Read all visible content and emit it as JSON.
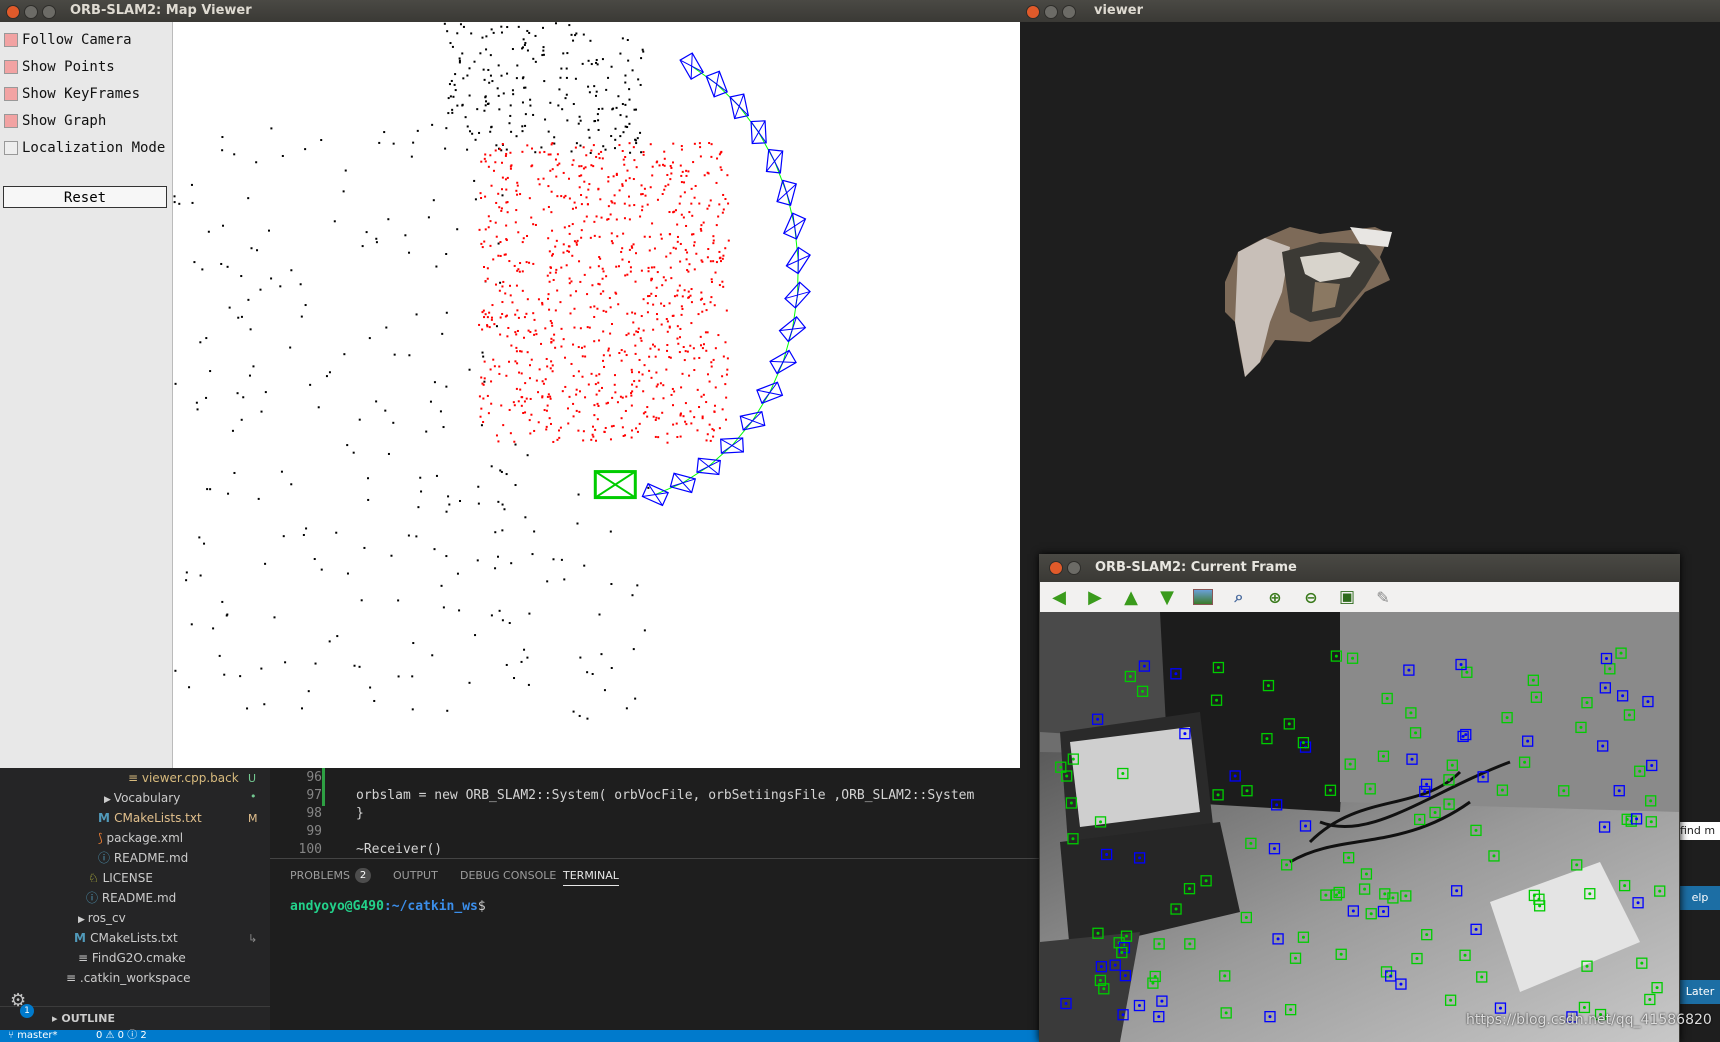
{
  "map_viewer": {
    "title": "ORB-SLAM2: Map Viewer",
    "options": [
      {
        "label": "Follow Camera",
        "checked": true
      },
      {
        "label": "Show Points",
        "checked": true
      },
      {
        "label": "Show KeyFrames",
        "checked": true
      },
      {
        "label": "Show Graph",
        "checked": true
      },
      {
        "label": "Localization Mode",
        "checked": false
      }
    ],
    "reset_label": "Reset"
  },
  "viewer": {
    "title": "viewer"
  },
  "current_frame": {
    "title": "ORB-SLAM2: Current Frame",
    "tools": [
      "arrow-left-icon",
      "arrow-right-icon",
      "arrow-up-icon",
      "arrow-down-icon",
      "image-icon",
      "zoom-fit-icon",
      "zoom-in-icon",
      "zoom-out-icon",
      "save-icon",
      "brush-icon"
    ]
  },
  "explorer": {
    "items": [
      {
        "label": "viewer.cpp.back",
        "badge": "U"
      },
      {
        "label": "Vocabulary",
        "badge": "•"
      },
      {
        "label": "CMakeLists.txt",
        "badge": "M"
      },
      {
        "label": "package.xml",
        "badge": ""
      },
      {
        "label": "README.md",
        "badge": ""
      },
      {
        "label": "LICENSE",
        "badge": ""
      },
      {
        "label": "README.md",
        "badge": ""
      },
      {
        "label": "ros_cv",
        "badge": ""
      },
      {
        "label": "CMakeLists.txt",
        "badge": ""
      },
      {
        "label": "FindG2O.cmake",
        "badge": ""
      },
      {
        "label": ".catkin_workspace",
        "badge": ""
      }
    ],
    "outline_label": "OUTLINE"
  },
  "code": {
    "lines": [
      {
        "n": "96",
        "text": ""
      },
      {
        "n": "97",
        "text": "  orbslam = new ORB_SLAM2::System( orbVocFile, orbSetiingsFile ,ORB_SLAM2::System"
      },
      {
        "n": "98",
        "text": "}"
      },
      {
        "n": "99",
        "text": ""
      },
      {
        "n": "100",
        "text": "~Receiver()"
      }
    ]
  },
  "panel": {
    "tabs": [
      "PROBLEMS",
      "OUTPUT",
      "DEBUG CONSOLE",
      "TERMINAL"
    ],
    "problems_count": "2",
    "prompt_user": "andyoyo@G490",
    "prompt_path": ":~/catkin_ws",
    "prompt_symbol": "$"
  },
  "statusbar": {
    "branch": "master*",
    "counts": "0 ⚠ 0 ⓘ 2"
  },
  "side_buttons": {
    "find": "find m",
    "help": "elp",
    "later": "Later"
  },
  "settings_badge": "1",
  "watermark": "https://blog.csdn.net/qq_41586820",
  "colors": {
    "keyframe": "#0000ff",
    "current_camera": "#00cc00",
    "graph": "#00ff00",
    "active_points": "#ff0000",
    "map_points": "#000000",
    "accent": "#007acc"
  }
}
